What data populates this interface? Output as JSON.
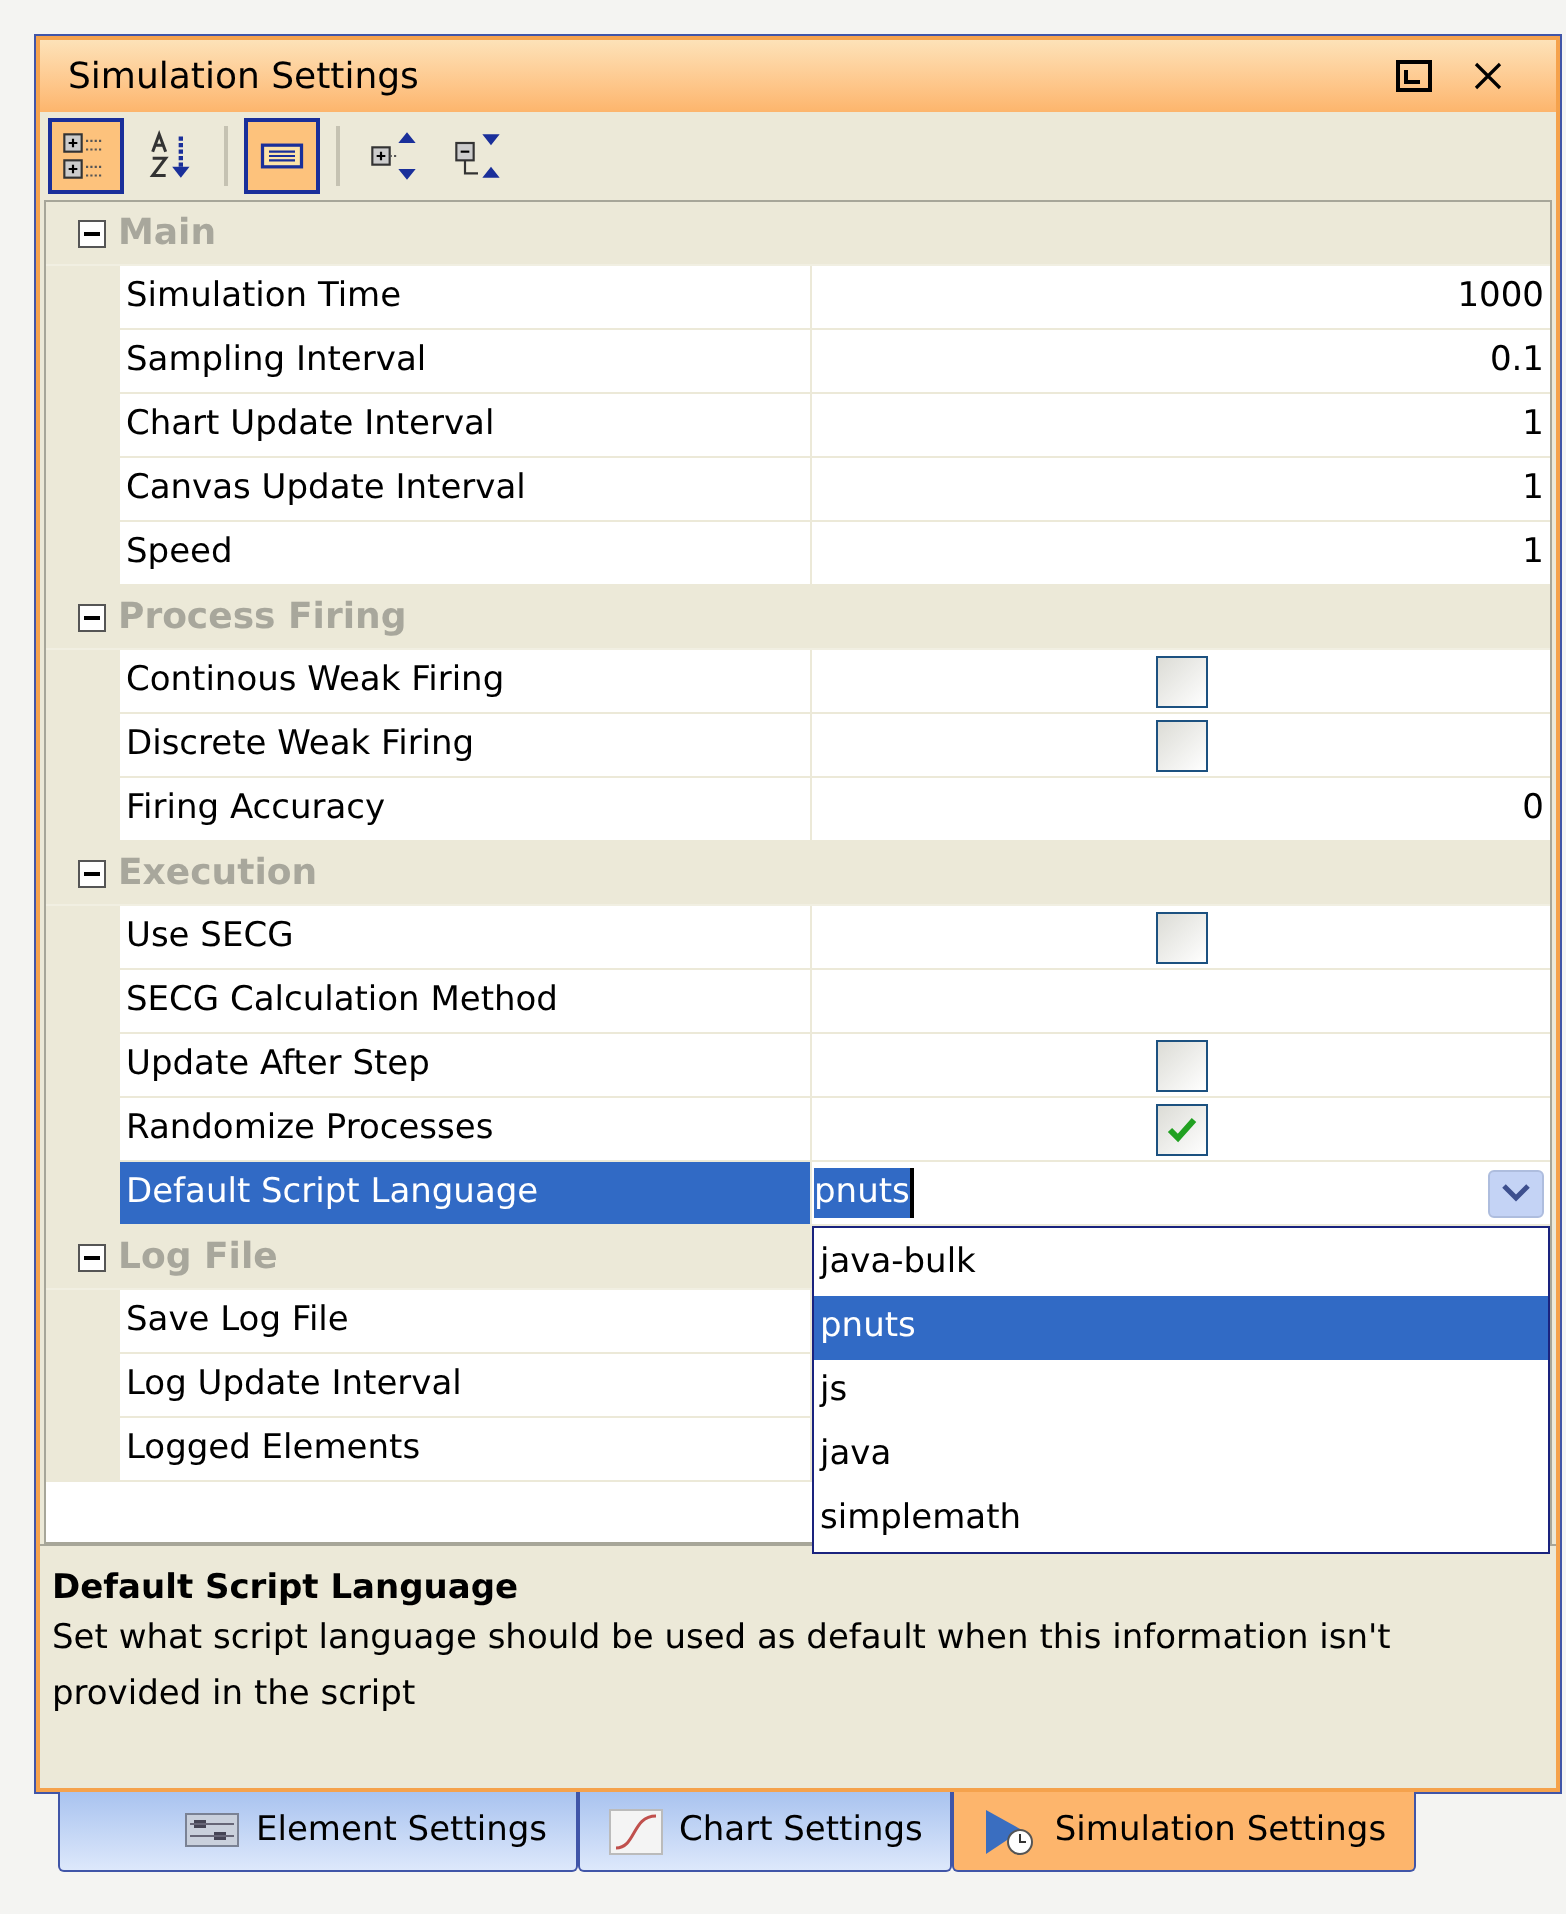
{
  "window": {
    "title": "Simulation Settings"
  },
  "toolbar": [
    {
      "kind": "categorized",
      "selected": true
    },
    {
      "kind": "alphabetical",
      "selected": false
    },
    {
      "kind": "separator"
    },
    {
      "kind": "pages",
      "selected": true
    },
    {
      "kind": "separator"
    },
    {
      "kind": "expand",
      "selected": false
    },
    {
      "kind": "collapse",
      "selected": false
    }
  ],
  "groups": [
    {
      "title": "Main",
      "expanded": true,
      "rows": [
        {
          "name": "Simulation Time",
          "kind": "text",
          "value": "1000",
          "selected": false
        },
        {
          "name": "Sampling Interval",
          "kind": "text",
          "value": "0.1",
          "selected": false
        },
        {
          "name": "Chart Update Interval",
          "kind": "text",
          "value": "1",
          "selected": false
        },
        {
          "name": "Canvas Update Interval",
          "kind": "text",
          "value": "1",
          "selected": false
        },
        {
          "name": "Speed",
          "kind": "text",
          "value": "1",
          "selected": false
        }
      ]
    },
    {
      "title": "Process Firing",
      "expanded": true,
      "rows": [
        {
          "name": "Continous Weak Firing",
          "kind": "checkbox",
          "checked": false,
          "selected": false
        },
        {
          "name": "Discrete Weak Firing",
          "kind": "checkbox",
          "checked": false,
          "selected": false
        },
        {
          "name": "Firing Accuracy",
          "kind": "text",
          "value": "0",
          "selected": false
        }
      ]
    },
    {
      "title": "Execution",
      "expanded": true,
      "rows": [
        {
          "name": "Use SECG",
          "kind": "checkbox",
          "checked": false,
          "selected": false
        },
        {
          "name": "SECG Calculation Method",
          "kind": "empty",
          "selected": false
        },
        {
          "name": "Update After Step",
          "kind": "checkbox",
          "checked": false,
          "selected": false
        },
        {
          "name": "Randomize Processes",
          "kind": "checkbox",
          "checked": true,
          "selected": false
        },
        {
          "name": "Default Script Language",
          "kind": "dropdown",
          "value": "pnuts",
          "selected": true,
          "options": [
            {
              "label": "java-bulk",
              "selected": false
            },
            {
              "label": "pnuts",
              "selected": true
            },
            {
              "label": "js",
              "selected": false
            },
            {
              "label": "java",
              "selected": false
            },
            {
              "label": "simplemath",
              "selected": false
            }
          ]
        }
      ]
    },
    {
      "title": "Log File",
      "expanded": true,
      "rows": [
        {
          "name": "Save Log File",
          "kind": "empty",
          "selected": false
        },
        {
          "name": "Log Update Interval",
          "kind": "empty",
          "selected": false
        },
        {
          "name": "Logged Elements",
          "kind": "empty",
          "selected": false
        }
      ]
    }
  ],
  "help": {
    "title": "Default Script Language",
    "text": "Set what script language should be used as default when this information isn't provided in the script"
  },
  "tabs": [
    {
      "label": "Element Settings",
      "kind": "element",
      "selected": false
    },
    {
      "label": "Chart Settings",
      "kind": "chart",
      "selected": false
    },
    {
      "label": "Simulation Settings",
      "kind": "simulation",
      "selected": true
    }
  ]
}
